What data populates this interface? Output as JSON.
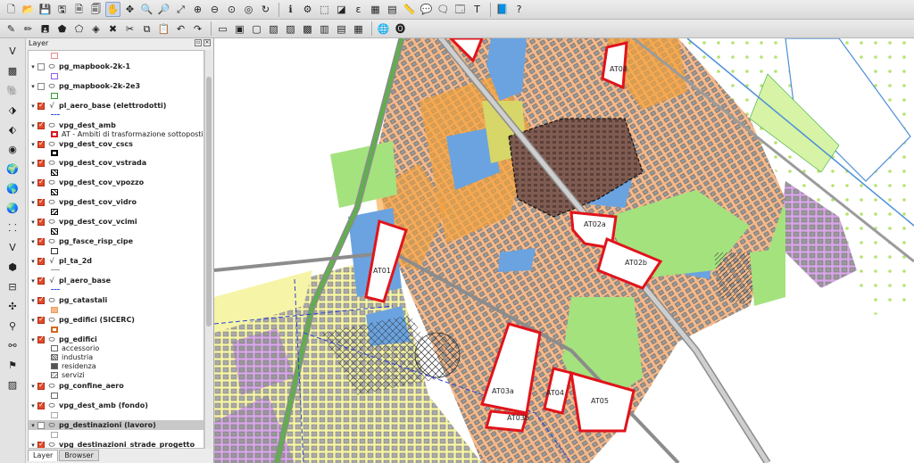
{
  "layers_panel": {
    "title": "Layer",
    "items": [
      {
        "name": "pg_mapbook-2k-1",
        "checked": false
      },
      {
        "name": "pg_mapbook-2k-2e3",
        "checked": false
      },
      {
        "name": "pl_aero_base (elettrodotti)",
        "checked": true
      },
      {
        "name": "vpg_dest_amb",
        "checked": true
      },
      {
        "name": "vpg_dest_cov_cscs",
        "checked": true
      },
      {
        "name": "vpg_dest_cov_vstrada",
        "checked": true
      },
      {
        "name": "vpg_dest_cov_vpozzo",
        "checked": true
      },
      {
        "name": "vpg_dest_cov_vidro",
        "checked": true
      },
      {
        "name": "vpg_dest_cov_vcimi",
        "checked": true
      },
      {
        "name": "pg_fasce_risp_cipe",
        "checked": true
      },
      {
        "name": "pl_ta_2d",
        "checked": true
      },
      {
        "name": "pl_aero_base",
        "checked": true
      },
      {
        "name": "pg_catastali",
        "checked": true
      },
      {
        "name": "pg_edifici (SICERC)",
        "checked": true
      },
      {
        "name": "pg_edifici",
        "checked": true
      },
      {
        "name": "pg_confine_aero",
        "checked": true
      },
      {
        "name": "vpg_dest_amb (fondo)",
        "checked": true
      },
      {
        "name": "pg_destinazioni (lavoro)",
        "checked": false
      },
      {
        "name": "vpg_destinazioni_strade_progetto",
        "checked": true
      }
    ],
    "dest_amb_legend": "AT - Ambiti di trasformazione sottoposti al...",
    "edifici_legend": [
      "accessorio",
      "industria",
      "residenza",
      "servizi"
    ],
    "tabs": [
      "Layer",
      "Browser"
    ]
  },
  "map_labels": [
    "AT08",
    "AT02a",
    "AT02b",
    "AT01",
    "AT03a",
    "AT03b",
    "AT04",
    "AT05"
  ],
  "colors": {
    "residential": "#f4b98c",
    "orange": "#f3a23c",
    "blue": "#6aa3e0",
    "green": "#a4e27e",
    "yellow": "#f6f4a6",
    "purple": "#d6a6e6",
    "dark_brown": "#7f5c52",
    "red": "#e0141c"
  }
}
